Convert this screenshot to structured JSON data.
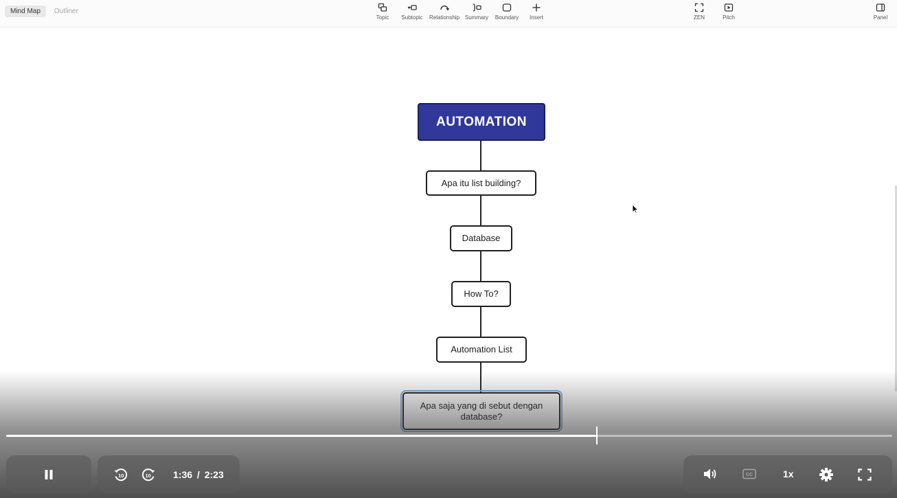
{
  "toolbar": {
    "view_tabs": [
      {
        "label": "Mind Map",
        "active": true
      },
      {
        "label": "Outliner",
        "active": false
      }
    ],
    "tools": [
      {
        "label": "Topic",
        "icon": "topic-icon"
      },
      {
        "label": "Subtopic",
        "icon": "subtopic-icon"
      },
      {
        "label": "Relationship",
        "icon": "relationship-icon"
      },
      {
        "label": "Summary",
        "icon": "summary-icon"
      },
      {
        "label": "Boundary",
        "icon": "boundary-icon"
      },
      {
        "label": "Insert",
        "icon": "plus-icon"
      },
      {
        "label": "ZEN",
        "icon": "zen-icon"
      },
      {
        "label": "Pitch",
        "icon": "play-icon"
      },
      {
        "label": "Panel",
        "icon": "panel-icon"
      }
    ]
  },
  "mindmap": {
    "root": "AUTOMATION",
    "topics": [
      "Apa itu list building?",
      "Database",
      "How To?",
      "Automation List",
      "Apa saja yang di sebut dengan database?"
    ],
    "root_color": "#30389c"
  },
  "player": {
    "current_time": "1:36",
    "separator": "/",
    "duration": "2:23",
    "progress": 0.666,
    "speed": "1x",
    "icons": [
      "pause-icon",
      "rewind-10-icon",
      "forward-10-icon",
      "volume-icon",
      "captions-icon",
      "settings-icon",
      "fullscreen-icon"
    ]
  }
}
